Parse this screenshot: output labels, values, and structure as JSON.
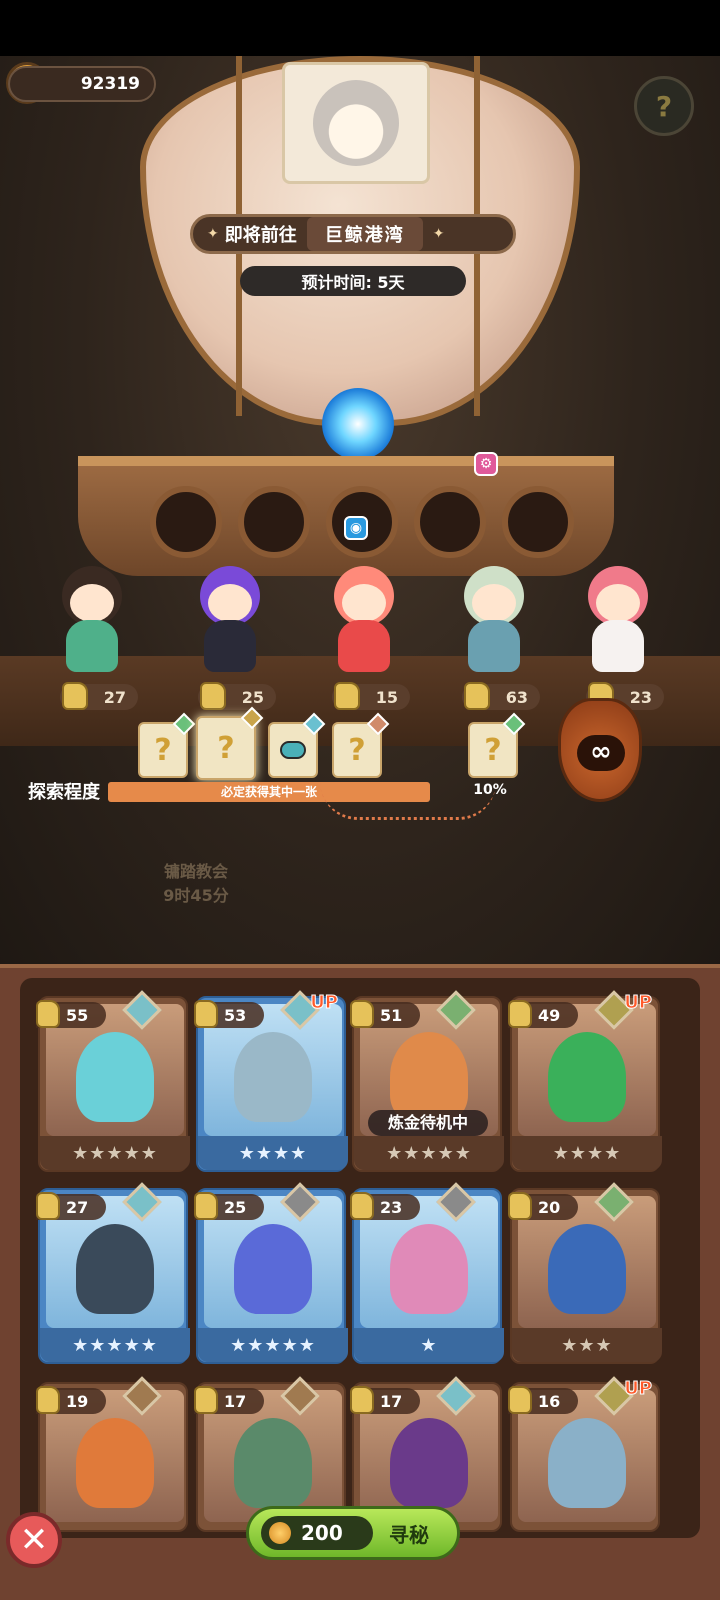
{
  "currency": {
    "amount": "92319",
    "icon": "crown-coin-icon"
  },
  "destination": {
    "label": "即将前往",
    "name": "巨鲸港湾"
  },
  "eta": {
    "text": "预计时间: 5天",
    "icon": "clock-icon"
  },
  "help_icon": "question-mark-icon",
  "crew": [
    {
      "level": "27",
      "hair": "#3a2a22",
      "body": "#4fb08a"
    },
    {
      "level": "25",
      "hair": "#7a4ad8",
      "body": "#2a2a38"
    },
    {
      "level": "15",
      "hair": "#ff8a7a",
      "body": "#e94a4a"
    },
    {
      "level": "63",
      "hair": "#cfe0c8",
      "body": "#6aa0b0"
    },
    {
      "level": "23",
      "hair": "#f07a8a",
      "body": "#f6f2f0"
    }
  ],
  "rewards": {
    "scroll_glyph": "?",
    "item_label": "potion",
    "gem_colors": [
      "#6ac07a",
      "#c9a44a",
      "#6ac0d0",
      "#d08a6a",
      "#6ac07a"
    ]
  },
  "exploration": {
    "label": "探索程度",
    "bar_text": "必定获得其中一张",
    "percent": "10%",
    "progress_value": 0.1
  },
  "pouch": {
    "symbol": "∞"
  },
  "map_text": {
    "place": "镛踏教会",
    "timer": "9时45分"
  },
  "heroes": [
    {
      "level": "55",
      "stars": "★★★★★",
      "style": "brown",
      "up": false,
      "elem": "#7ac0c8",
      "hair": "#6ad0d8"
    },
    {
      "level": "53",
      "stars": "★★★★",
      "style": "blue",
      "up": true,
      "elem": "#7ac0c8",
      "hair": "#9ab8c8"
    },
    {
      "level": "51",
      "stars": "★★★★★",
      "style": "brown",
      "up": false,
      "elem": "#7ab070",
      "hair": "#e08a4a",
      "tag": "炼金待机中"
    },
    {
      "level": "49",
      "stars": "★★★★",
      "style": "brown",
      "up": true,
      "elem": "#b0a050",
      "hair": "#3ab05a"
    },
    {
      "level": "27",
      "stars": "★★★★★",
      "style": "blue",
      "up": false,
      "elem": "#7ac0c8",
      "hair": "#3a4a5a"
    },
    {
      "level": "25",
      "stars": "★★★★★",
      "style": "blue",
      "up": false,
      "elem": "#8a8a8a",
      "hair": "#5a6ad8"
    },
    {
      "level": "23",
      "stars": "★",
      "style": "blue",
      "up": false,
      "elem": "#8a8a8a",
      "hair": "#e08ab8"
    },
    {
      "level": "20",
      "stars": "★★★",
      "style": "brown",
      "up": false,
      "elem": "#7ab070",
      "hair": "#3a6ab8"
    },
    {
      "level": "19",
      "stars": "",
      "style": "brown",
      "up": false,
      "elem": "#a07a50",
      "hair": "#e07a3a"
    },
    {
      "level": "17",
      "stars": "",
      "style": "brown",
      "up": false,
      "elem": "#a07a50",
      "hair": "#5a8a6a"
    },
    {
      "level": "17",
      "stars": "",
      "style": "brown",
      "up": false,
      "elem": "#7ac0c8",
      "hair": "#6a3a8a"
    },
    {
      "level": "16",
      "stars": "",
      "style": "brown",
      "up": true,
      "elem": "#b0a050",
      "hair": "#8ab0c8"
    }
  ],
  "actions": {
    "close": "✕",
    "cost": "200",
    "seek": "寻秘"
  }
}
